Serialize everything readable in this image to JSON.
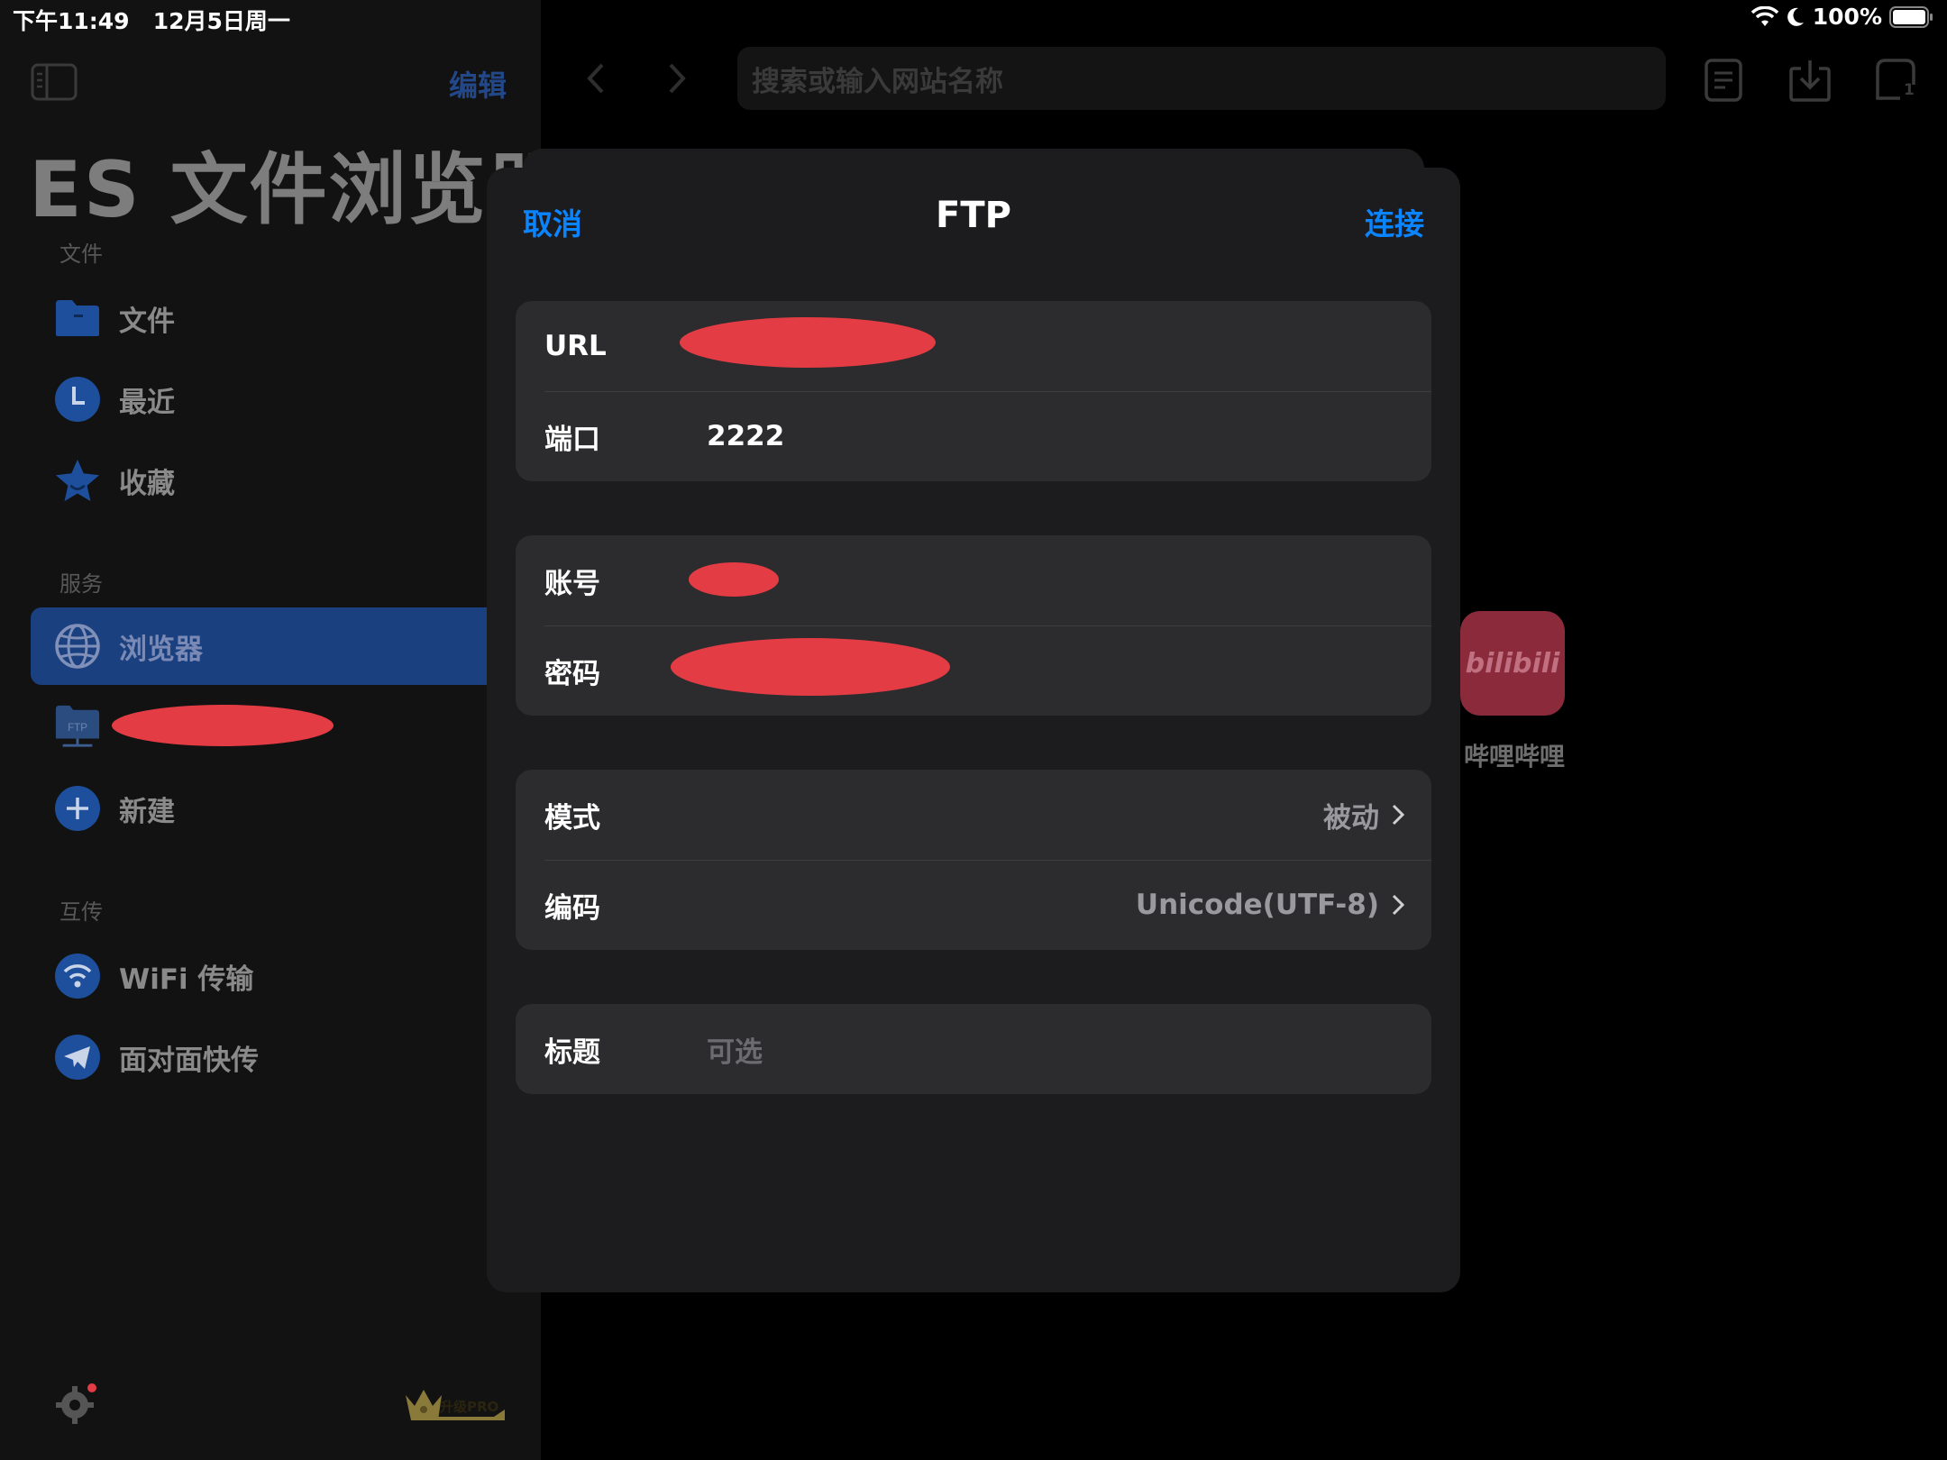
{
  "status_bar": {
    "time": "下午11:49",
    "date": "12月5日周一",
    "battery": "100%"
  },
  "sidebar": {
    "edit_label": "编辑",
    "app_title": "ES 文件浏览器",
    "sections": {
      "files": "文件",
      "services": "服务",
      "transfer": "互传"
    },
    "items": {
      "files": "文件",
      "recent": "最近",
      "favorites": "收藏",
      "browser": "浏览器",
      "ftp_icon_text": "FTP",
      "new": "新建",
      "wifi_transfer": "WiFi 传输",
      "face_to_face": "面对面快传"
    },
    "upgrade_label": "升级PRO"
  },
  "browser": {
    "search_placeholder": "搜索或输入网站名称",
    "tab_count": "1",
    "shortcut": {
      "icon_text": "bilibili",
      "label": "哔哩哔哩"
    }
  },
  "modal": {
    "cancel_label": "取消",
    "title": "FTP",
    "connect_label": "连接",
    "fields": {
      "url_label": "URL",
      "port_label": "端口",
      "port_value": "2222",
      "account_label": "账号",
      "password_label": "密码",
      "mode_label": "模式",
      "mode_value": "被动",
      "encoding_label": "编码",
      "encoding_value": "Unicode(UTF-8)",
      "title_label": "标题",
      "title_placeholder": "可选"
    }
  },
  "colors": {
    "accent": "#0a84ff",
    "redaction": "#e43c44",
    "active_item": "#1a4080",
    "group_bg": "#2c2c2e"
  }
}
